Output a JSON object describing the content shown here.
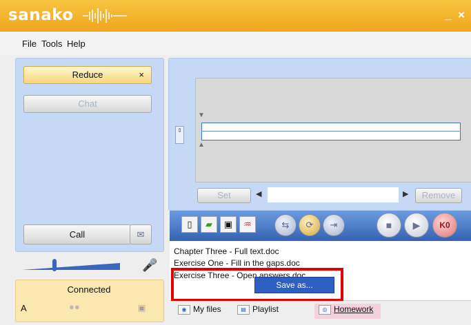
{
  "app": {
    "logo_text": "sanako",
    "window_controls": {
      "minimize": "_",
      "close": "×"
    }
  },
  "menubar": {
    "items": [
      "File",
      "Tools",
      "Help"
    ]
  },
  "left_panel": {
    "reduce_label": "Reduce",
    "reduce_close": "×",
    "chat_label": "Chat",
    "call_label": "Call",
    "message_icon": "✉"
  },
  "volume": {
    "level": 0.33
  },
  "status": {
    "text": "Connected",
    "channel": "A"
  },
  "editor": {
    "set_label": "Set",
    "remove_label": "Remove",
    "left_arrow": "◀",
    "right_arrow": "▶",
    "side_button": "⇕",
    "marker_top": "▼",
    "marker_bottom": "▲"
  },
  "toolbar": {
    "file_icons": [
      "new-document-icon",
      "open-folder-icon",
      "save-icon",
      "waveform-icon"
    ],
    "round_icons": [
      "swap-icon",
      "repeat-icon",
      "export-icon"
    ],
    "transport": [
      "stop-icon",
      "play-icon",
      "record-icon"
    ],
    "record_label": "K0"
  },
  "files": {
    "items": [
      "Chapter Three - Full text.doc",
      "Exercise One - Fill in the gaps.doc",
      "Exercise Three - Open answers.doc"
    ],
    "context_menu": {
      "save_as": "Save as..."
    }
  },
  "tabs": [
    {
      "label": "My files"
    },
    {
      "label": "Playlist"
    },
    {
      "label": "Homework",
      "active": true
    }
  ]
}
